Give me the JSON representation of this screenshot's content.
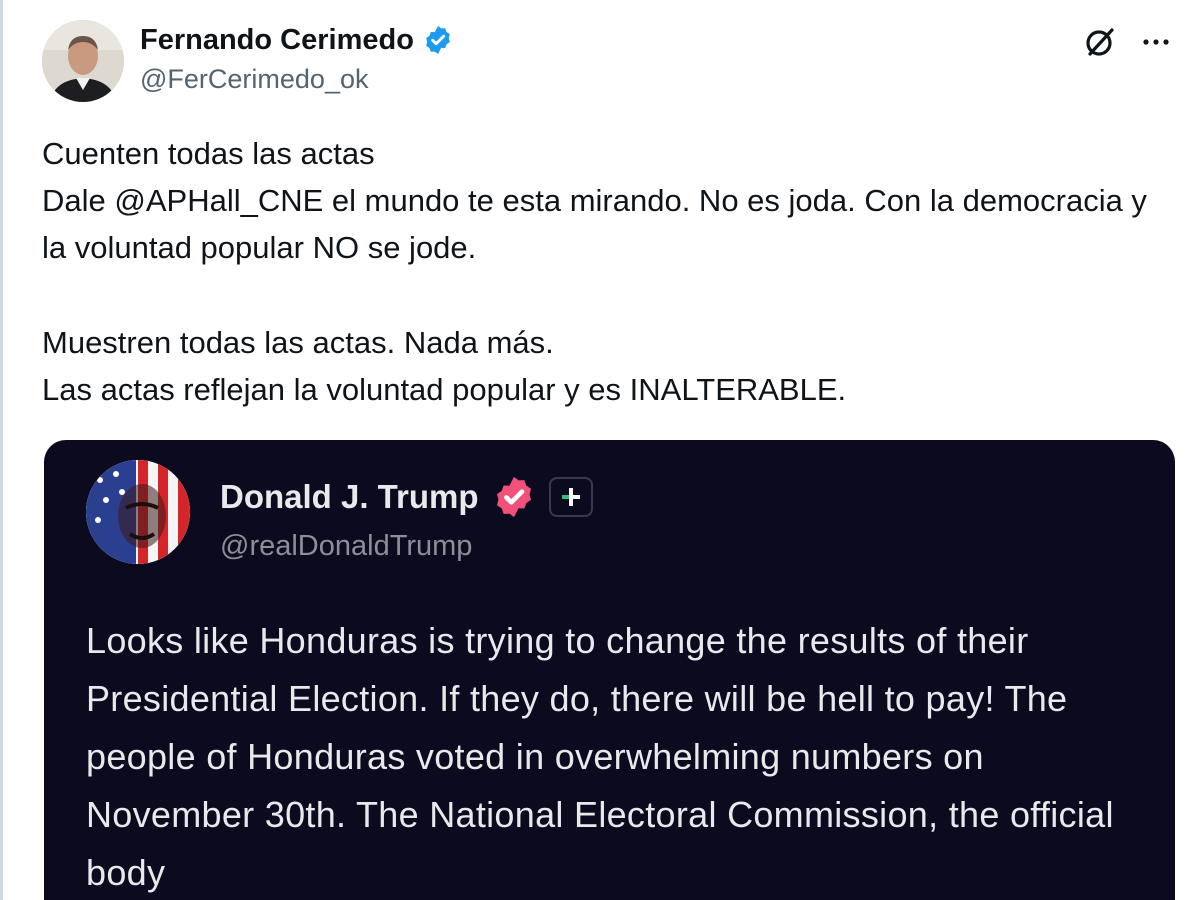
{
  "author": {
    "name": "Fernando Cerimedo",
    "handle": "@FerCerimedo_ok",
    "verified": true,
    "verified_color": "#1d9bf0"
  },
  "header_icons": [
    "grok-icon",
    "more-options-icon"
  ],
  "tweet": {
    "lines": [
      "Cuenten todas las actas",
      "Dale @APHall_CNE el mundo te esta mirando. No es joda. Con la democracia y la voluntad popular NO se jode.",
      "Muestren todas las actas. Nada más.",
      "Las actas reflejan la voluntad popular y es INALTERABLE."
    ]
  },
  "quote": {
    "name": "Donald J. Trump",
    "handle": "@realDonaldTrump",
    "badge_color": "#f0507a",
    "background": "#0c0a1f",
    "text": "Looks like Honduras is trying to change the results of their Presidential Election. If they do, there will be hell to pay! The people of Honduras voted in overwhelming numbers on November 30th. The National Electoral Commission, the official body"
  }
}
